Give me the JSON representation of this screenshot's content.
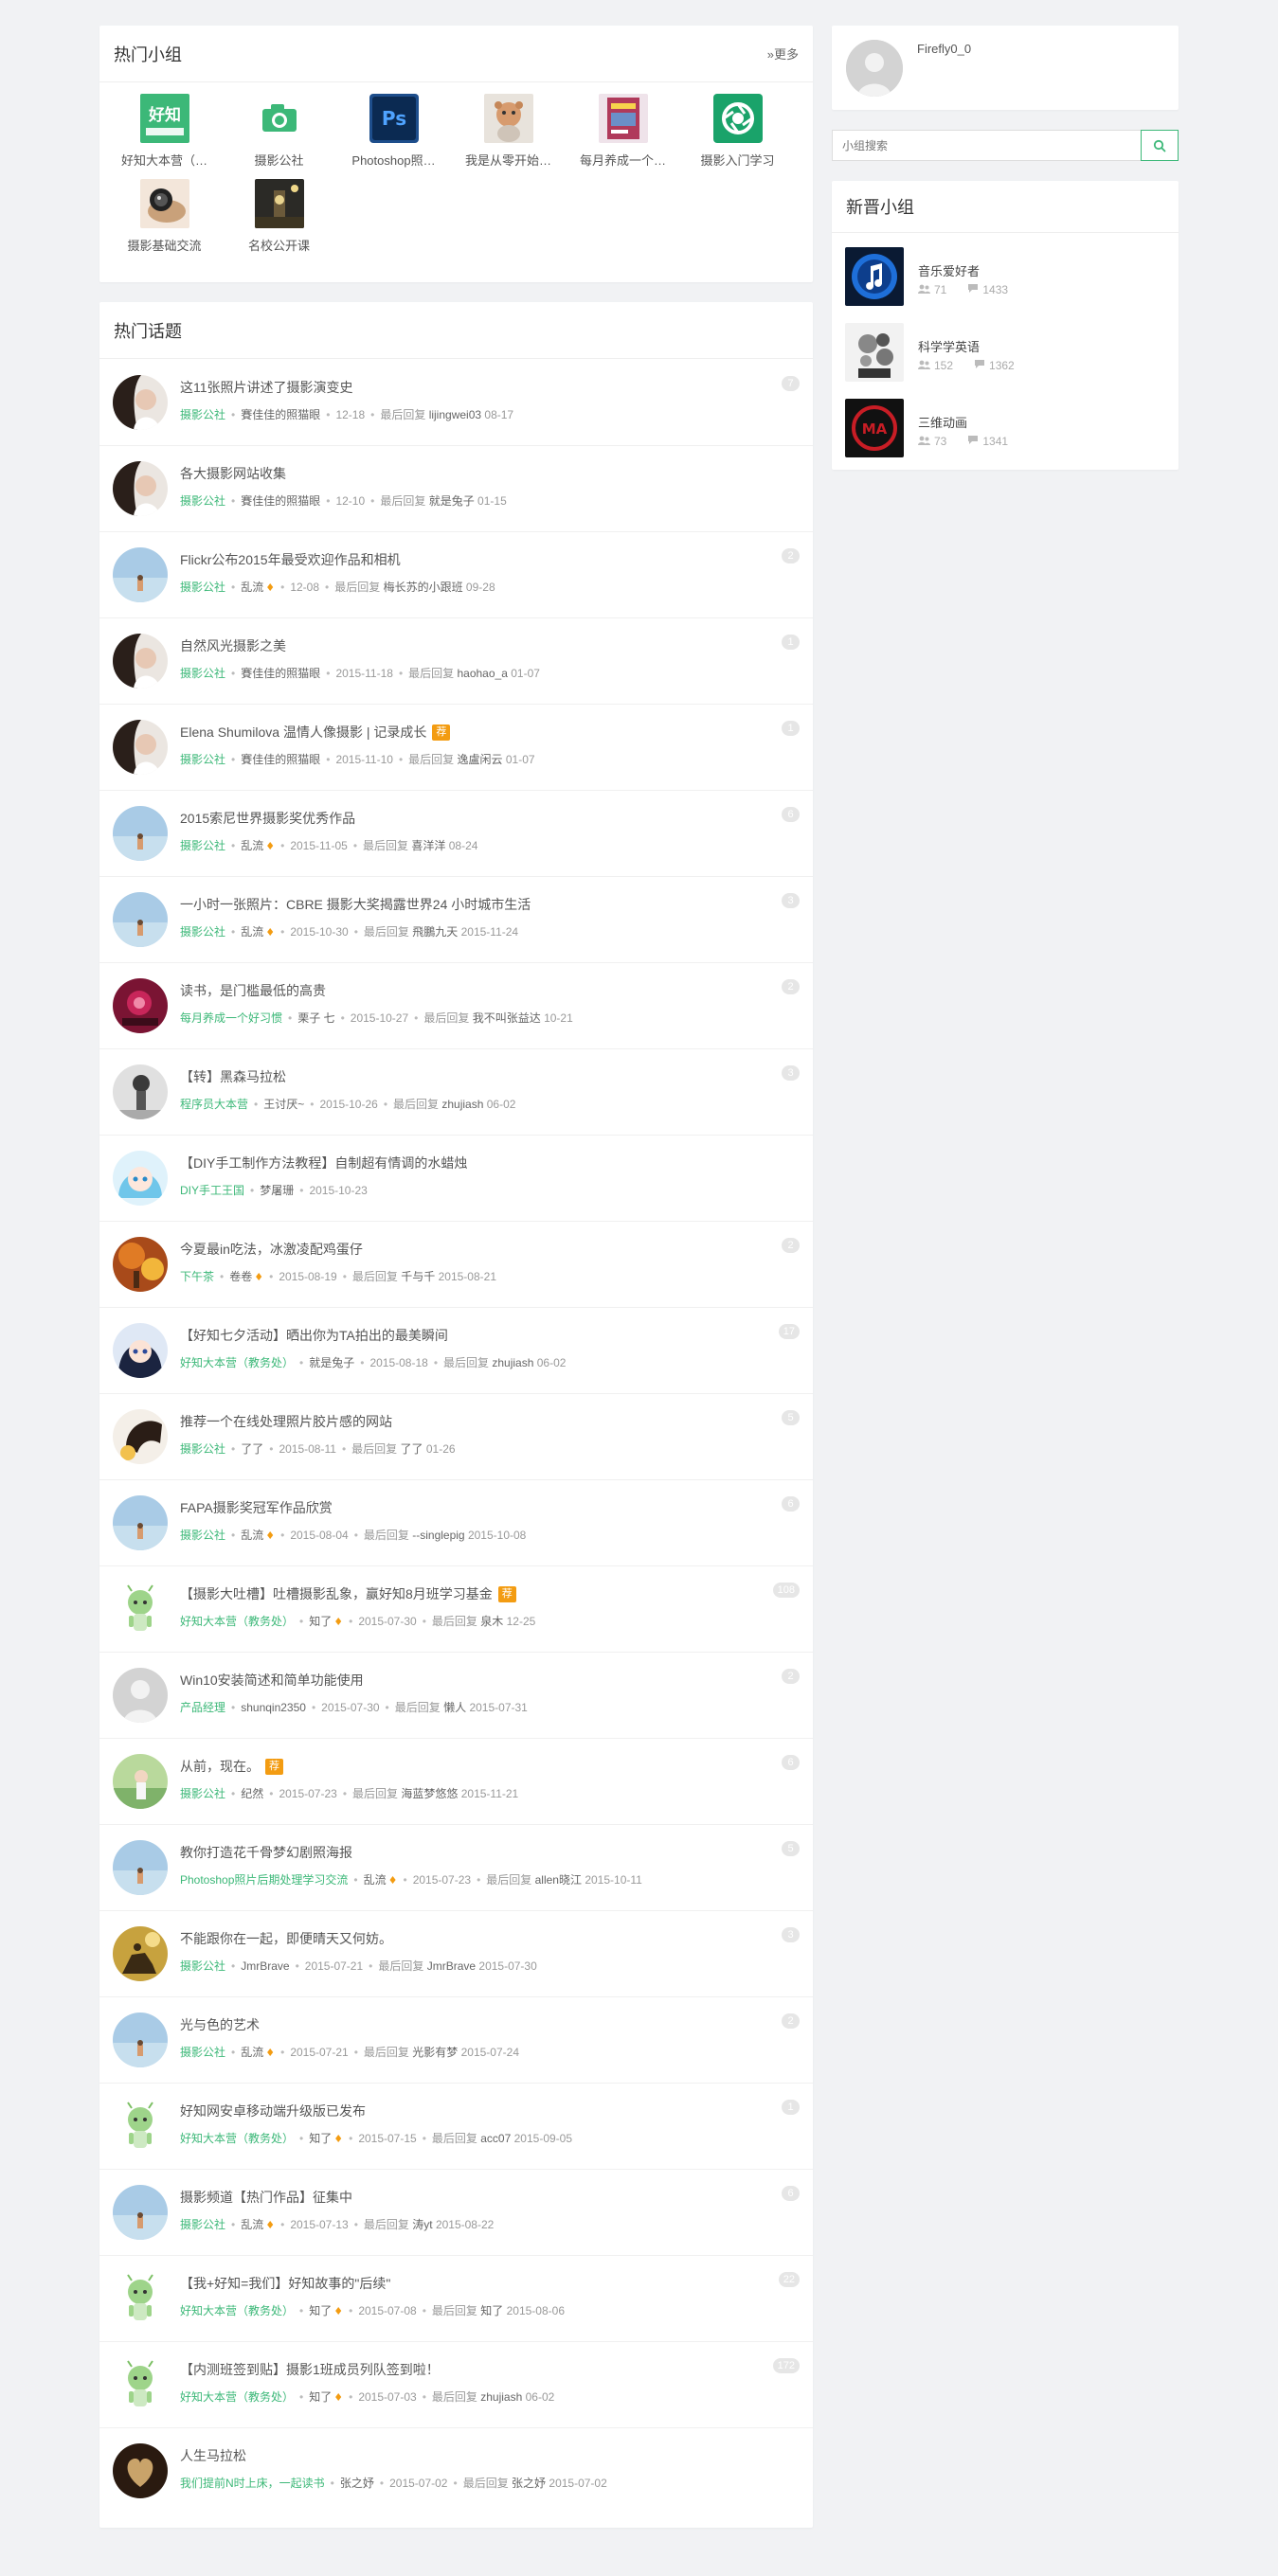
{
  "hot_groups": {
    "title": "热门小组",
    "more_label": "»更多",
    "items": [
      {
        "name": "好知大本营（…",
        "icon": "haozhi-logo-icon",
        "color": "#3cb878",
        "label": "好知"
      },
      {
        "name": "摄影公社",
        "icon": "camera-icon",
        "color": "#3cb878",
        "label": ""
      },
      {
        "name": "Photoshop照…",
        "icon": "photoshop-icon",
        "color": "#1e4e8c",
        "label": "Ps"
      },
      {
        "name": "我是从零开始…",
        "icon": "doll-icon",
        "color": "#cfc4b8",
        "label": ""
      },
      {
        "name": "每月养成一个…",
        "icon": "book-cover-icon",
        "color": "#b03a5b",
        "label": ""
      },
      {
        "name": "摄影入门学习",
        "icon": "aperture-icon",
        "color": "#1aa36a",
        "label": ""
      },
      {
        "name": "摄影基础交流",
        "icon": "hand-lens-icon",
        "color": "#c9a17a",
        "label": ""
      },
      {
        "name": "名校公开课",
        "icon": "clock-tower-icon",
        "color": "#6b5a3a",
        "label": ""
      }
    ]
  },
  "hot_topics": {
    "title": "热门话题",
    "last_reply_label": "最后回复",
    "items": [
      {
        "title": "这11张照片讲述了摄影演变史",
        "group": "摄影公社",
        "user": "賽佳佳的照猫眼",
        "fire": false,
        "date": "12-18",
        "last_user": "lijingwei03",
        "last_date": "08-17",
        "count": "7",
        "avatar": "woman-dark",
        "top": false
      },
      {
        "title": "各大摄影网站收集",
        "group": "摄影公社",
        "user": "賽佳佳的照猫眼",
        "fire": false,
        "date": "12-10",
        "last_user": "就是兔子",
        "last_date": "01-15",
        "count": "",
        "avatar": "woman-dark",
        "top": false
      },
      {
        "title": "Flickr公布2015年最受欢迎作品和相机",
        "group": "摄影公社",
        "user": "乱流",
        "fire": true,
        "date": "12-08",
        "last_user": "梅长苏的小跟班",
        "last_date": "09-28",
        "count": "2",
        "avatar": "sea-boy",
        "top": false
      },
      {
        "title": "自然风光摄影之美",
        "group": "摄影公社",
        "user": "賽佳佳的照猫眼",
        "fire": false,
        "date": "2015-11-18",
        "last_user": "haohao_a",
        "last_date": "01-07",
        "count": "1",
        "avatar": "woman-dark",
        "top": false
      },
      {
        "title": "Elena Shumilova 温情人像摄影 | 记录成长",
        "group": "摄影公社",
        "user": "賽佳佳的照猫眼",
        "fire": false,
        "date": "2015-11-10",
        "last_user": "逸盧闲云",
        "last_date": "01-07",
        "count": "1",
        "avatar": "woman-dark",
        "top": true
      },
      {
        "title": "2015索尼世界摄影奖优秀作品",
        "group": "摄影公社",
        "user": "乱流",
        "fire": true,
        "date": "2015-11-05",
        "last_user": "喜洋洋",
        "last_date": "08-24",
        "count": "6",
        "avatar": "sea-boy",
        "top": false
      },
      {
        "title": "一小时一张照片：CBRE 摄影大奖揭露世界24 小时城市生活",
        "group": "摄影公社",
        "user": "乱流",
        "fire": true,
        "date": "2015-10-30",
        "last_user": "飛鵬九天",
        "last_date": "2015-11-24",
        "count": "3",
        "avatar": "sea-boy",
        "top": false
      },
      {
        "title": "读书，是门槛最低的高贵",
        "group": "每月养成一个好习惯",
        "user": "栗子 七",
        "fire": false,
        "date": "2015-10-27",
        "last_user": "我不叫张益达",
        "last_date": "10-21",
        "count": "2",
        "avatar": "flower-red",
        "top": false
      },
      {
        "title": "【转】黑森马拉松",
        "group": "程序员大本营",
        "user": "王讨厌~",
        "fire": false,
        "date": "2015-10-26",
        "last_user": "zhujiash",
        "last_date": "06-02",
        "count": "3",
        "avatar": "bw-girl",
        "top": false
      },
      {
        "title": "【DIY手工制作方法教程】自制超有情调的水蜡烛",
        "group": "DIY手工王国",
        "user": "梦屠珊",
        "fire": false,
        "date": "2015-10-23",
        "last_user": "",
        "last_date": "",
        "count": "",
        "avatar": "anime-blue",
        "top": false
      },
      {
        "title": "今夏最in吃法，冰激凌配鸡蛋仔",
        "group": "下午茶",
        "user": "卷卷",
        "fire": true,
        "date": "2015-08-19",
        "last_user": "千与千",
        "last_date": "2015-08-21",
        "count": "2",
        "avatar": "autumn",
        "top": false
      },
      {
        "title": "【好知七夕活动】晒出你为TA拍出的最美瞬间",
        "group": "好知大本营（教务处）",
        "user": "就是兔子",
        "fire": false,
        "date": "2015-08-18",
        "last_user": "zhujiash",
        "last_date": "06-02",
        "count": "17",
        "avatar": "anime-dark",
        "top": false
      },
      {
        "title": "推荐一个在线处理照片胶片感的网站",
        "group": "摄影公社",
        "user": "了了",
        "fire": false,
        "date": "2015-08-11",
        "last_user": "了了",
        "last_date": "01-26",
        "count": "5",
        "avatar": "horse",
        "top": false
      },
      {
        "title": "FAPA摄影奖冠军作品欣赏",
        "group": "摄影公社",
        "user": "乱流",
        "fire": true,
        "date": "2015-08-04",
        "last_user": "--singlepig",
        "last_date": "2015-10-08",
        "count": "6",
        "avatar": "sea-boy",
        "top": false
      },
      {
        "title": "【摄影大吐槽】吐槽摄影乱象，赢好知8月班学习基金",
        "group": "好知大本营（教务处）",
        "user": "知了",
        "fire": true,
        "date": "2015-07-30",
        "last_user": "泉木",
        "last_date": "12-25",
        "count": "108",
        "avatar": "zhiliao",
        "top": true
      },
      {
        "title": "Win10安装简述和简单功能使用",
        "group": "产品经理",
        "user": "shunqin2350",
        "fire": false,
        "date": "2015-07-30",
        "last_user": "懒人",
        "last_date": "2015-07-31",
        "count": "2",
        "avatar": "default",
        "top": false
      },
      {
        "title": "从前，现在。",
        "group": "摄影公社",
        "user": "纪然",
        "fire": false,
        "date": "2015-07-23",
        "last_user": "海蓝梦悠悠",
        "last_date": "2015-11-21",
        "count": "6",
        "avatar": "green-girl",
        "top": true
      },
      {
        "title": "教你打造花千骨梦幻剧照海报",
        "group": "Photoshop照片后期处理学习交流",
        "user": "乱流",
        "fire": true,
        "date": "2015-07-23",
        "last_user": "allen晓江",
        "last_date": "2015-10-11",
        "count": "5",
        "avatar": "sea-boy",
        "top": false
      },
      {
        "title": "不能跟你在一起，即便晴天又何妨。",
        "group": "摄影公社",
        "user": "JmrBrave",
        "fire": false,
        "date": "2015-07-21",
        "last_user": "JmrBrave",
        "last_date": "2015-07-30",
        "count": "3",
        "avatar": "rider",
        "top": false
      },
      {
        "title": "光与色的艺术",
        "group": "摄影公社",
        "user": "乱流",
        "fire": true,
        "date": "2015-07-21",
        "last_user": "光影有梦",
        "last_date": "2015-07-24",
        "count": "2",
        "avatar": "sea-boy",
        "top": false
      },
      {
        "title": "好知网安卓移动端升级版已发布",
        "group": "好知大本营（教务处）",
        "user": "知了",
        "fire": true,
        "date": "2015-07-15",
        "last_user": "acc07",
        "last_date": "2015-09-05",
        "count": "1",
        "avatar": "zhiliao",
        "top": false
      },
      {
        "title": "摄影频道【热门作品】征集中",
        "group": "摄影公社",
        "user": "乱流",
        "fire": true,
        "date": "2015-07-13",
        "last_user": "涛yt",
        "last_date": "2015-08-22",
        "count": "6",
        "avatar": "sea-boy",
        "top": false
      },
      {
        "title": "【我+好知=我们】好知故事的\"后续\"",
        "group": "好知大本营（教务处）",
        "user": "知了",
        "fire": true,
        "date": "2015-07-08",
        "last_user": "知了",
        "last_date": "2015-08-06",
        "count": "22",
        "avatar": "zhiliao",
        "top": false
      },
      {
        "title": "【内测班签到贴】摄影1班成员列队签到啦！",
        "group": "好知大本营（教务处）",
        "user": "知了",
        "fire": true,
        "date": "2015-07-03",
        "last_user": "zhujiash",
        "last_date": "06-02",
        "count": "172",
        "avatar": "zhiliao",
        "top": false
      },
      {
        "title": "人生马拉松",
        "group": "我们提前N时上床，一起读书",
        "user": "张之妤",
        "fire": false,
        "date": "2015-07-02",
        "last_user": "张之妤",
        "last_date": "2015-07-02",
        "count": "",
        "avatar": "heart",
        "top": false
      }
    ],
    "top_badge": "荐"
  },
  "user": {
    "name": "Firefly0_0",
    "avatar_icon": "default-avatar-icon"
  },
  "search": {
    "placeholder": "小组搜索",
    "button_icon": "search-icon"
  },
  "new_groups": {
    "title": "新晋小组",
    "items": [
      {
        "name": "音乐爱好者",
        "members": "71",
        "topics": "1433",
        "icon": "music-note-icon"
      },
      {
        "name": "科学学英语",
        "members": "152",
        "topics": "1362",
        "icon": "brain-gears-icon"
      },
      {
        "name": "三维动画",
        "members": "73",
        "topics": "1341",
        "icon": "maya-logo-icon"
      }
    ]
  },
  "colors": {
    "accent": "#3cb878",
    "badge": "#f39c12",
    "count_bg": "#e6e6e6"
  }
}
